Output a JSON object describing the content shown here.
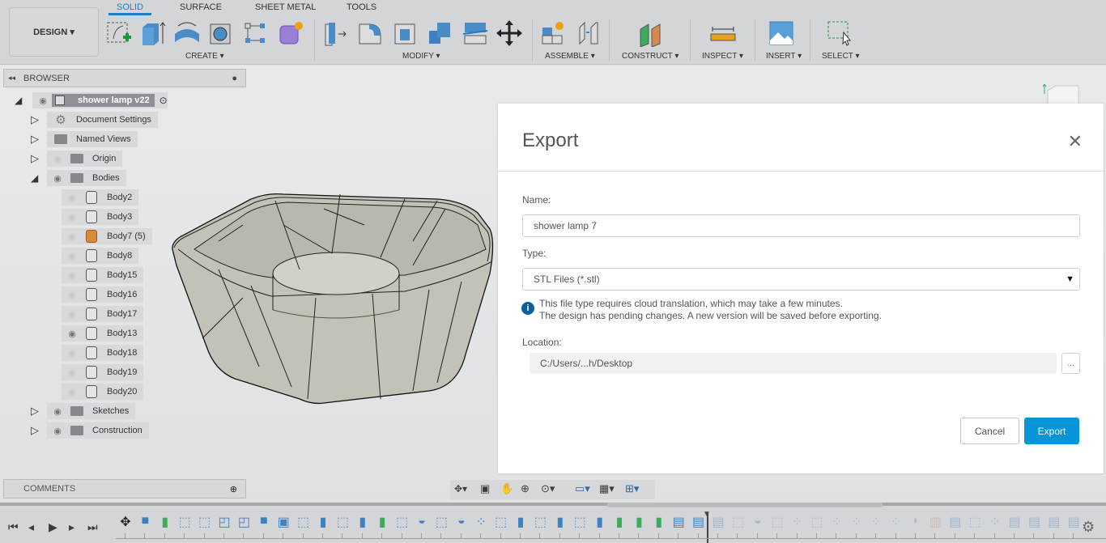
{
  "toolbar": {
    "workspace": "DESIGN",
    "tabs": [
      "SOLID",
      "SURFACE",
      "SHEET METAL",
      "TOOLS"
    ],
    "active_tab": "SOLID",
    "groups": [
      "CREATE",
      "MODIFY",
      "ASSEMBLE",
      "CONSTRUCT",
      "INSPECT",
      "INSERT",
      "SELECT"
    ]
  },
  "browser": {
    "title": "BROWSER",
    "root": "shower lamp v22",
    "items": [
      {
        "label": "Document Settings",
        "icon": "gear-icon",
        "eye": null,
        "exp": "collapsed",
        "lvl": 1
      },
      {
        "label": "Named Views",
        "icon": "folder-icon",
        "eye": null,
        "exp": "collapsed",
        "lvl": 1
      },
      {
        "label": "Origin",
        "icon": "folder-icon",
        "eye": "hidden",
        "exp": "collapsed",
        "lvl": 1
      },
      {
        "label": "Bodies",
        "icon": "folder-icon",
        "eye": "visible",
        "exp": "expanded",
        "lvl": 1
      },
      {
        "label": "Body2",
        "icon": "body-icon",
        "eye": "hidden",
        "lvl": 2
      },
      {
        "label": "Body3",
        "icon": "body-icon",
        "eye": "hidden",
        "lvl": 2
      },
      {
        "label": "Body7 (5)",
        "icon": "body-selected-icon",
        "eye": "hidden",
        "lvl": 2
      },
      {
        "label": "Body8",
        "icon": "body-icon",
        "eye": "hidden",
        "lvl": 2
      },
      {
        "label": "Body15",
        "icon": "body-icon",
        "eye": "hidden",
        "lvl": 2
      },
      {
        "label": "Body16",
        "icon": "body-icon",
        "eye": "hidden",
        "lvl": 2
      },
      {
        "label": "Body17",
        "icon": "body-icon",
        "eye": "hidden",
        "lvl": 2
      },
      {
        "label": "Body13",
        "icon": "body-icon",
        "eye": "visible",
        "lvl": 2
      },
      {
        "label": "Body18",
        "icon": "body-icon",
        "eye": "hidden",
        "lvl": 2
      },
      {
        "label": "Body19",
        "icon": "body-icon",
        "eye": "hidden",
        "lvl": 2
      },
      {
        "label": "Body20",
        "icon": "body-icon",
        "eye": "hidden",
        "lvl": 2
      },
      {
        "label": "Sketches",
        "icon": "folder-icon",
        "eye": "visible",
        "exp": "collapsed",
        "lvl": 1
      },
      {
        "label": "Construction",
        "icon": "folder-icon",
        "eye": "visible",
        "exp": "collapsed",
        "lvl": 1
      }
    ]
  },
  "comments": {
    "title": "COMMENTS"
  },
  "dialog": {
    "title": "Export",
    "name_label": "Name:",
    "name_value": "shower lamp 7",
    "type_label": "Type:",
    "type_value": "STL Files (*.stl)",
    "info_line1": "This file type requires cloud translation, which may take a few minutes.",
    "info_line2": "The design has pending changes.  A new version will be saved before exporting.",
    "location_label": "Location:",
    "location_value": "C:/Users/...h/Desktop",
    "browse": "...",
    "cancel": "Cancel",
    "export": "Export"
  },
  "colors": {
    "accent": "#0696d7",
    "tab_active": "#1b7fc4"
  },
  "timeline": {
    "marker_index": 30,
    "features": [
      "move",
      "combine",
      "plane",
      "sketch",
      "sketch",
      "shell",
      "shell",
      "combine",
      "box",
      "sketch",
      "extrude",
      "sketch",
      "extrude",
      "plane",
      "sketch",
      "revolve",
      "sketch",
      "revolve",
      "pattern",
      "sketch",
      "extrude",
      "sketch",
      "extrude",
      "sketch",
      "extrude",
      "plane",
      "plane",
      "plane",
      "split",
      "split",
      "split",
      "sketch",
      "revolve",
      "sketch",
      "pattern",
      "sketch",
      "pattern",
      "pattern",
      "pattern",
      "pattern",
      "patch",
      "joint",
      "split",
      "sketch",
      "pattern",
      "split",
      "split",
      "split",
      "split"
    ]
  }
}
